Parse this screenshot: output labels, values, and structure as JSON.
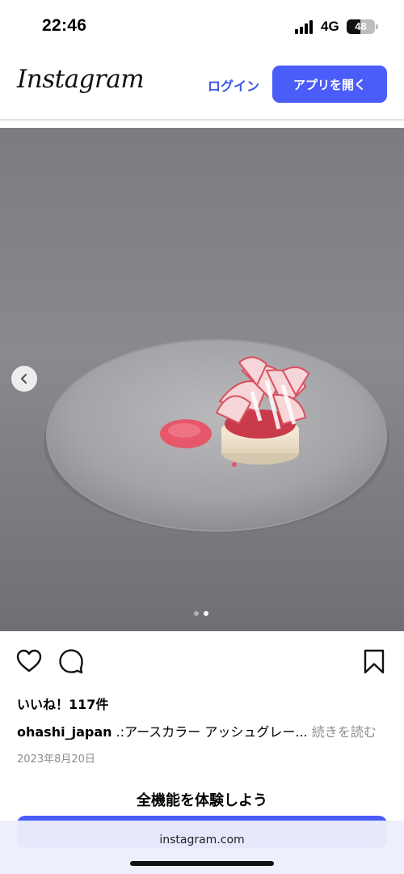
{
  "status": {
    "time": "22:46",
    "network": "4G",
    "battery": "48",
    "battery_level": 0.48
  },
  "header": {
    "logo": "Instagram",
    "login_label": "ログイン",
    "open_app_label": "アプリを開く"
  },
  "post": {
    "carousel": {
      "total": 2,
      "current": 2
    },
    "likes": "いいね！117件",
    "username": "ohashi_japan",
    "caption": " .:アースカラー アッシュグレー... ",
    "more_label": "続きを読む",
    "date": "2023年8月20日"
  },
  "promo": {
    "title": "全機能を体験しよう"
  },
  "browser": {
    "url": "instagram.com"
  },
  "colors": {
    "accent": "#4a5df9",
    "link": "#3b55e6"
  },
  "icons": [
    "heart-icon",
    "comment-icon",
    "bookmark-icon",
    "chevron-left-icon"
  ]
}
